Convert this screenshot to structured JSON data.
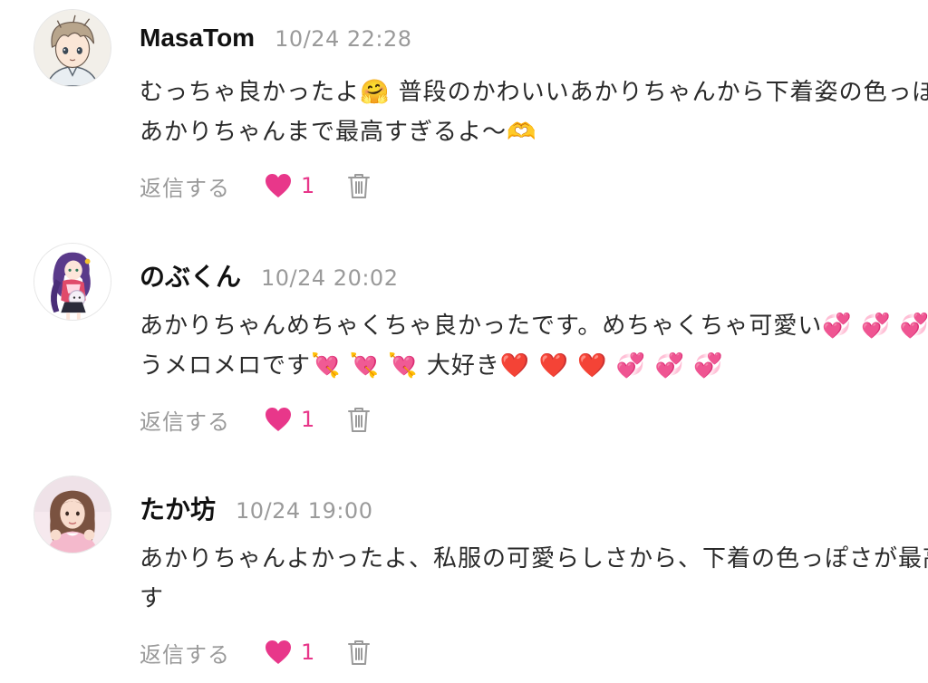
{
  "comments": [
    {
      "username": "MasaTom",
      "timestamp": "10/24 22:28",
      "lines": [
        "むっちゃ良かったよ🤗 普段のかわいいあかりちゃんから下着姿の色っぽい",
        "あかりちゃんまで最高すぎるよ〜🫶"
      ],
      "reply_label": "返信する",
      "likes": "1",
      "avatar_icon": "anime-boy-avatar"
    },
    {
      "username": "のぶくん",
      "timestamp": "10/24 20:02",
      "lines": [
        "あかりちゃんめちゃくちゃ良かったです。めちゃくちゃ可愛い💞 💞 💞 も",
        "うメロメロです💘 💘 💘 大好き❤️ ❤️ ❤️ 💞 💞 💞"
      ],
      "reply_label": "返信する",
      "likes": "1",
      "avatar_icon": "anime-girl-avatar"
    },
    {
      "username": "たか坊",
      "timestamp": "10/24 19:00",
      "lines": [
        "あかりちゃんよかったよ、私服の可愛らしさから、下着の色っぽさが最高で",
        "す"
      ],
      "reply_label": "返信する",
      "likes": "1",
      "avatar_icon": "photo-girl-avatar"
    }
  ],
  "colors": {
    "heart": "#e8378a",
    "muted": "#9a9a9a",
    "text": "#2a2a2a"
  }
}
